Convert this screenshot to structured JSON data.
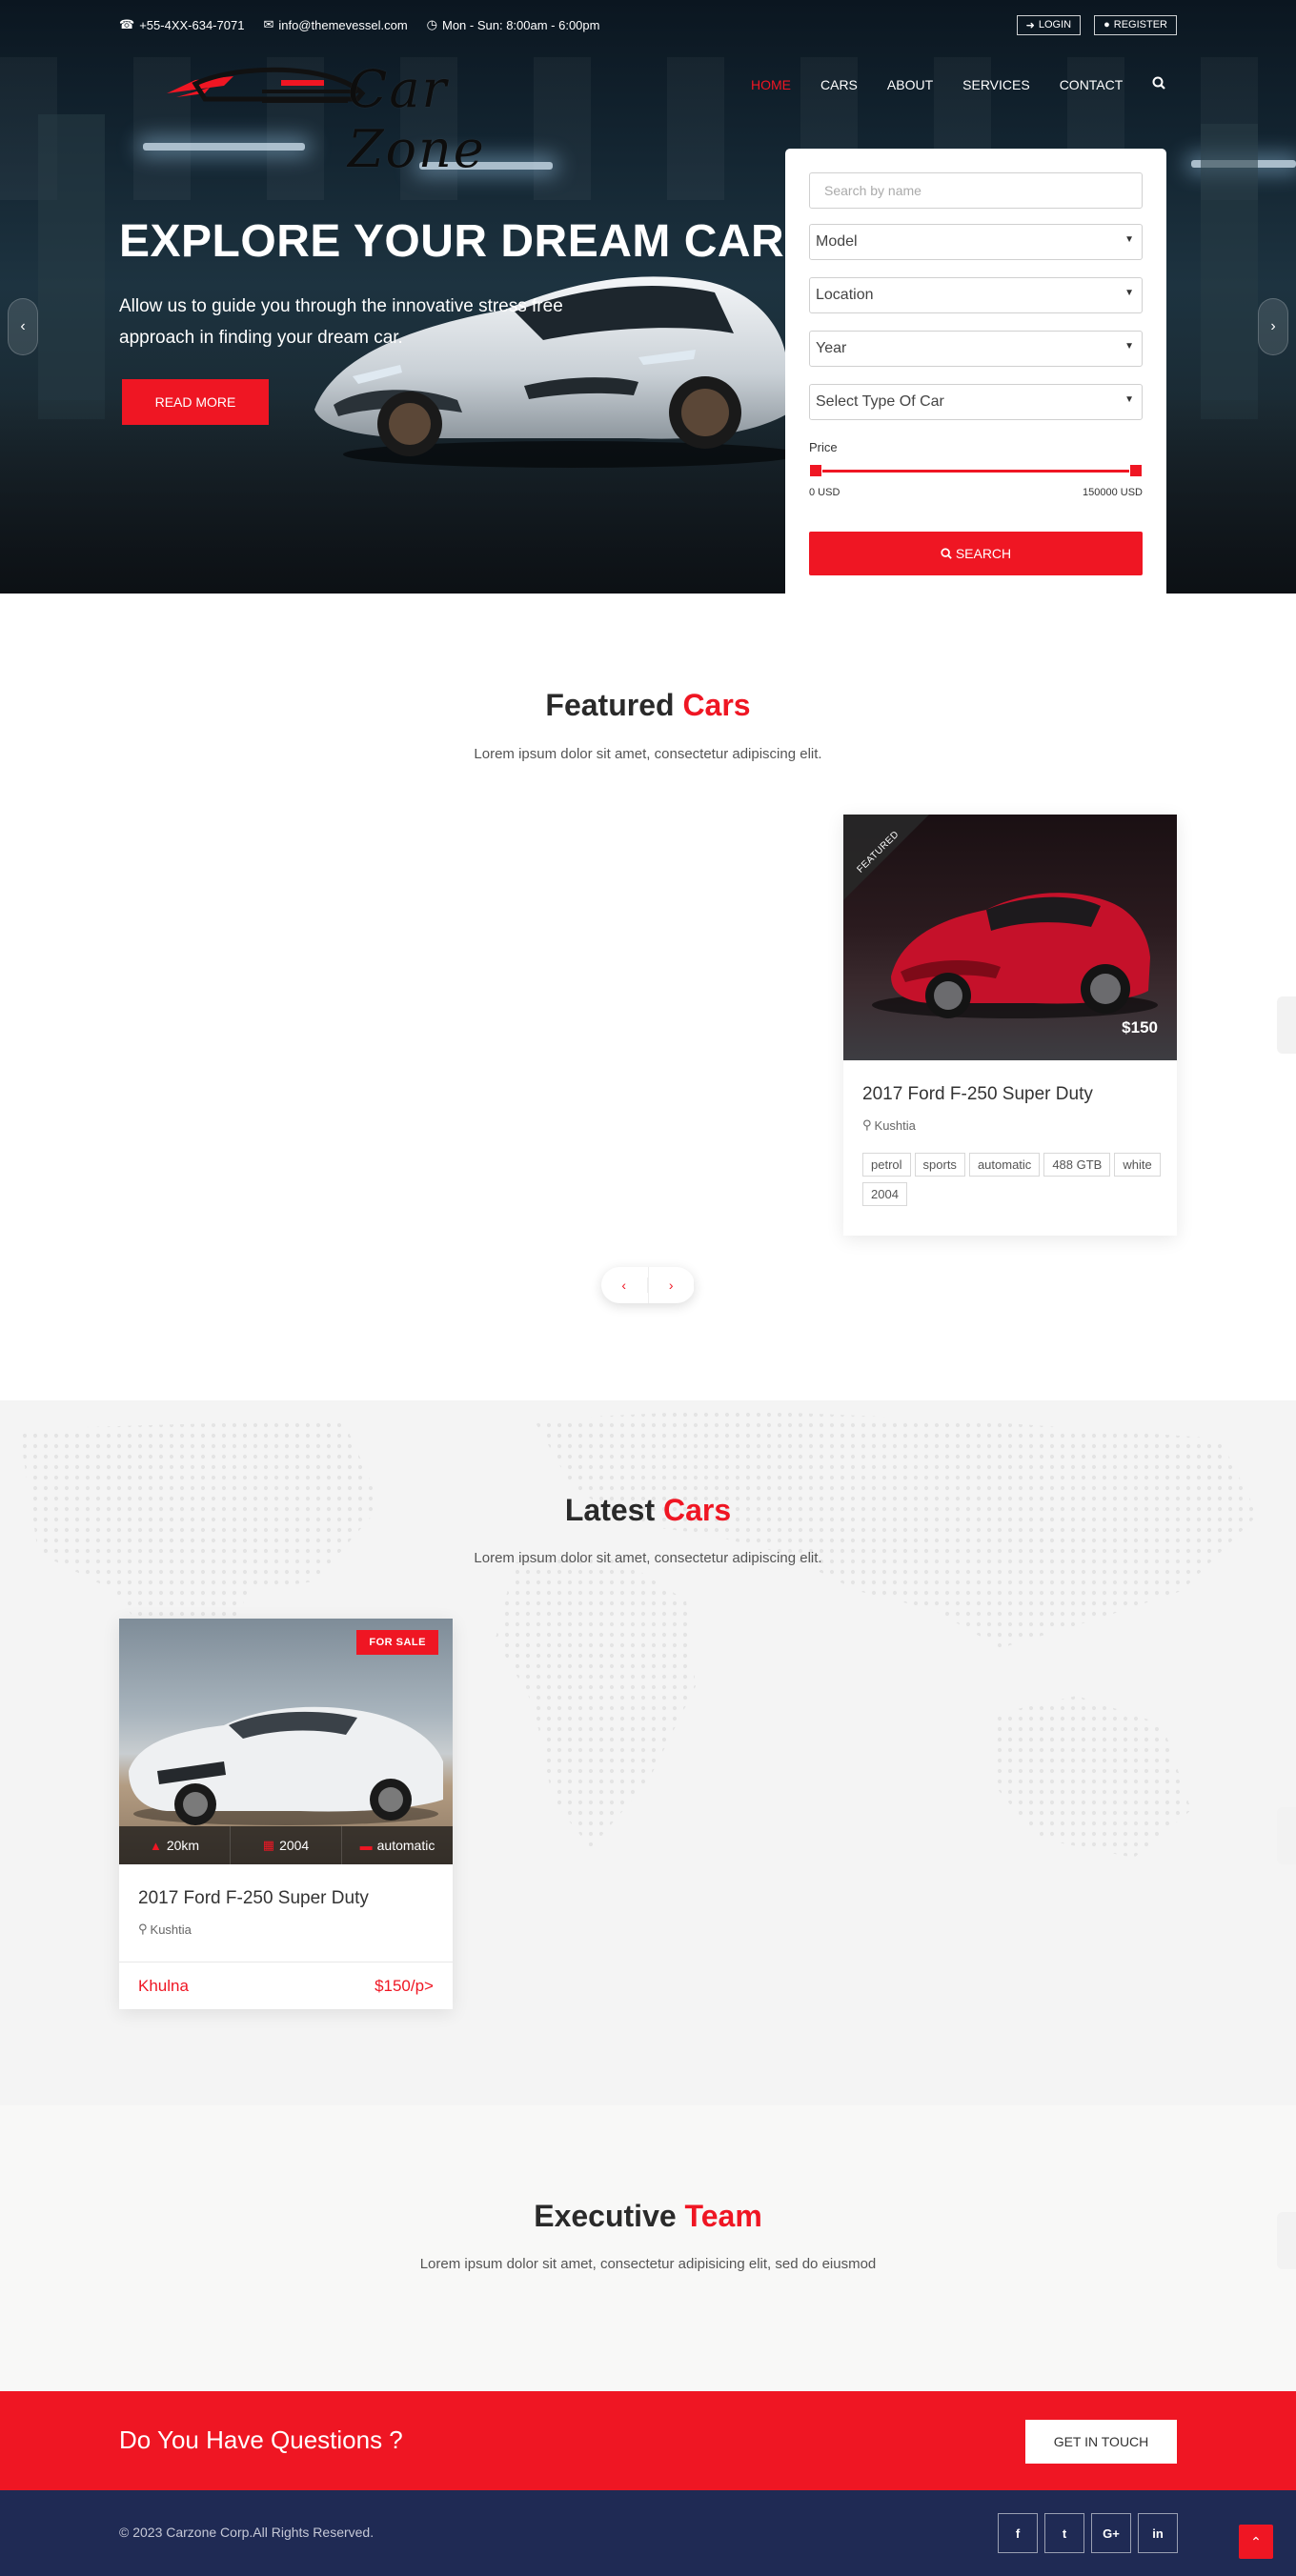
{
  "topbar": {
    "phone": "+55-4XX-634-7071",
    "email": "info@themevessel.com",
    "hours": "Mon - Sun: 8:00am - 6:00pm",
    "login_label": "LOGIN",
    "register_label": "REGISTER"
  },
  "logo": {
    "text": "Car Zone"
  },
  "nav": {
    "items": [
      "HOME",
      "CARS",
      "ABOUT",
      "SERVICES",
      "CONTACT"
    ],
    "active": "HOME"
  },
  "hero": {
    "title": "EXPLORE YOUR DREAM CAR",
    "text": "Allow us to guide you through the innovative stress free approach in finding your dream car.",
    "read_more_label": "READ MORE",
    "prev_icon": "chevron-left",
    "next_icon": "chevron-right"
  },
  "search": {
    "name_placeholder": "Search by name",
    "model": "Model",
    "location": "Location",
    "year": "Year",
    "type": "Select Type Of Car",
    "price_label": "Price",
    "price_min": "0 USD",
    "price_max": "150000 USD",
    "price_range_fraction": [
      0.0,
      1.0
    ],
    "button_label": "SEARCH"
  },
  "featured": {
    "title_a": "Featured",
    "title_b": "Cars",
    "subtitle": "Lorem ipsum dolor sit amet, consectetur adipiscing elit.",
    "card": {
      "ribbon": "FEATURED",
      "price": "$150",
      "title": "2017 Ford F-250 Super Duty",
      "location": "Kushtia",
      "tags": [
        "petrol",
        "sports",
        "automatic",
        "488 GTB",
        "white",
        "2004"
      ]
    }
  },
  "latest": {
    "title_a": "Latest",
    "title_b": "Cars",
    "subtitle": "Lorem ipsum dolor sit amet, consectetur adipiscing elit.",
    "card": {
      "badge": "FOR SALE",
      "mileage": "20km",
      "year": "2004",
      "transmission": "automatic",
      "title": "2017 Ford F-250 Super Duty",
      "location": "Kushtia",
      "city": "Khulna",
      "price": "$150/p>"
    }
  },
  "executive": {
    "title_a": "Executive",
    "title_b": "Team",
    "subtitle": "Lorem ipsum dolor sit amet, consectetur adipisicing elit, sed do eiusmod"
  },
  "cta": {
    "text": "Do You Have Questions ?",
    "button_label": "GET IN TOUCH"
  },
  "footer": {
    "copyright": "© 2023 Carzone Corp.All Rights Reserved.",
    "socials": [
      "f",
      "t",
      "G+",
      "in"
    ]
  },
  "colors": {
    "accent": "#ef1623",
    "footer": "#1f2a54",
    "cta": "#ef1623"
  }
}
